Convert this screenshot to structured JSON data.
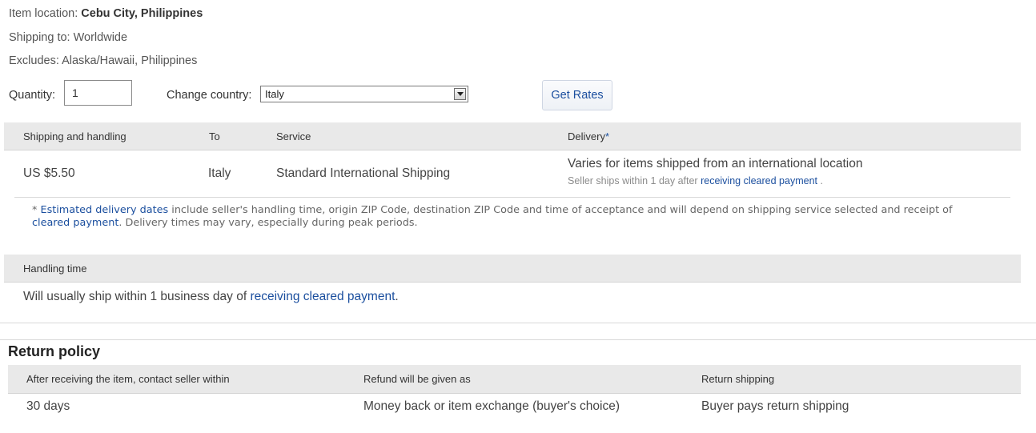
{
  "item_info": {
    "location_label": "Item location:",
    "location_value": "Cebu City, Philippines",
    "shipping_to": "Shipping to: Worldwide",
    "excludes": "Excludes: Alaska/Hawaii, Philippines"
  },
  "controls": {
    "quantity_label": "Quantity:",
    "quantity_value": "1",
    "country_label": "Change country:",
    "country_value": "Italy",
    "get_rates_label": "Get Rates"
  },
  "shipping_table": {
    "headers": {
      "shipping": "Shipping and handling",
      "to": "To",
      "service": "Service",
      "delivery": "Delivery",
      "delivery_mark": "*"
    },
    "row": {
      "cost": "US $5.50",
      "to": "Italy",
      "service": "Standard International Shipping",
      "delivery": "Varies for items shipped from an international location",
      "delivery_note_prefix": "Seller ships within 1 day after",
      "delivery_note_link": "receiving cleared payment",
      "delivery_note_suffix": "."
    }
  },
  "footnote": {
    "star": "*",
    "link1": "Estimated delivery dates",
    "text1": "include seller's handling time, origin ZIP Code, destination ZIP Code and time of acceptance and will depend on shipping service selected and receipt of",
    "link2": "cleared payment",
    "text2": ". Delivery times may vary, especially during peak periods."
  },
  "handling": {
    "header": "Handling time",
    "text_prefix": "Will usually ship within 1 business day of",
    "link": "receiving cleared payment",
    "suffix": "."
  },
  "return_policy": {
    "title": "Return policy",
    "headers": {
      "contact": "After receiving the item, contact seller within",
      "refund": "Refund will be given as",
      "shipping": "Return shipping"
    },
    "row": {
      "contact": "30 days",
      "refund": "Money back or item exchange (buyer's choice)",
      "shipping": "Buyer pays return shipping"
    }
  },
  "colors": {
    "link": "#1a4e9e",
    "header_bg": "#e9e9e9",
    "text": "#333333"
  }
}
